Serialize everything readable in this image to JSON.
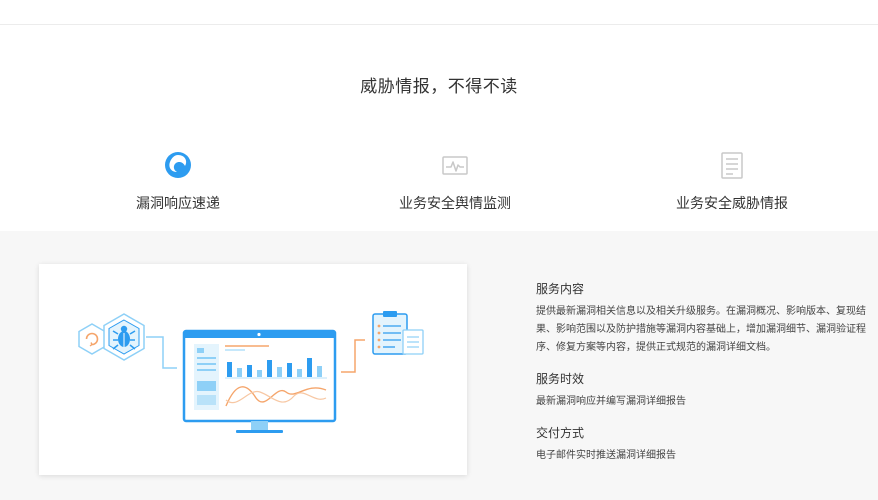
{
  "header": {
    "title": "威胁情报，不得不读"
  },
  "tabs": [
    {
      "label": "漏洞响应速递",
      "icon": "swirl-logo-icon",
      "active": true,
      "color": "#2d9cf0"
    },
    {
      "label": "业务安全舆情监测",
      "icon": "monitor-pulse-icon",
      "active": false
    },
    {
      "label": "业务安全威胁情报",
      "icon": "document-lines-icon",
      "active": false
    }
  ],
  "details": {
    "service_content_title": "服务内容",
    "service_content_text": "提供最新漏洞相关信息以及相关升级服务。在漏洞概况、影响版本、复现结果、影响范围以及防护措施等漏洞内容基础上，增加漏洞细节、漏洞验证程序、修复方案等内容，提供正式规范的漏洞详细文档。",
    "timeliness_title": "服务时效",
    "timeliness_text": "最新漏洞响应并编写漏洞详细报告",
    "delivery_title": "交付方式",
    "delivery_text": "电子邮件实时推送漏洞详细报告"
  },
  "colors": {
    "accent": "#2d9cf0",
    "accent_light": "#8ed0f7",
    "orange": "#f5a56b",
    "panel_bg": "#f7f7f7",
    "inactive_icon": "#c8c8c8"
  }
}
